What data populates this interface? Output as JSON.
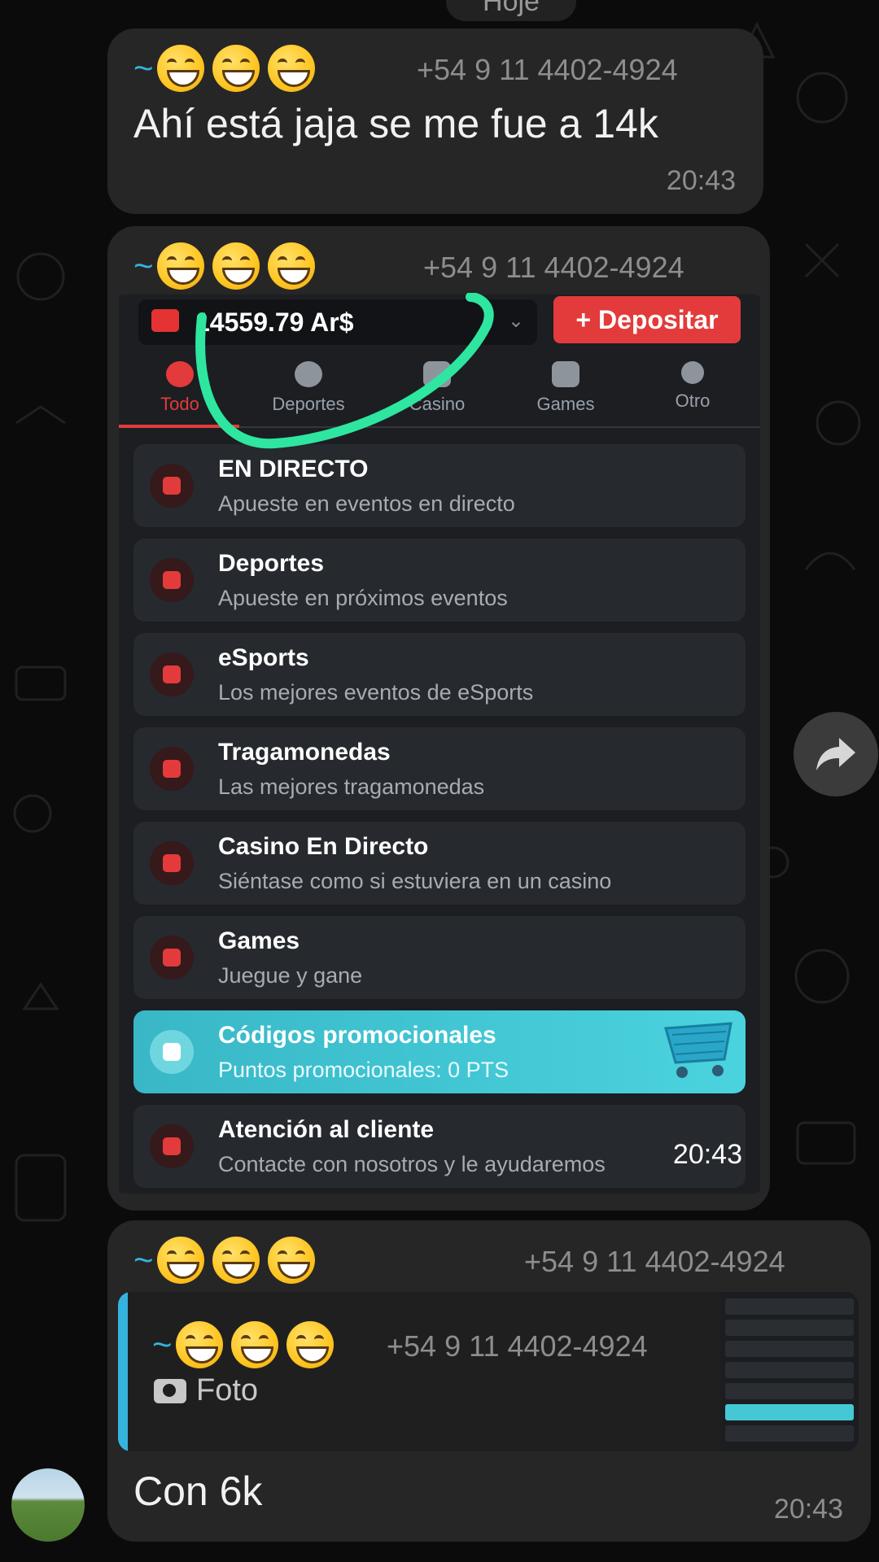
{
  "date_chip": "Hoje",
  "messages": [
    {
      "sender_prefix": "~",
      "phone": "+54 9 11 4402-4924",
      "text": "Ahí está jaja se me fue a 14k",
      "time": "20:43"
    },
    {
      "sender_prefix": "~",
      "phone": "+54 9 11 4402-4924",
      "time": "20:43",
      "screenshot": {
        "balance": "14559.79 Ar$",
        "deposit_label": "+ Depositar",
        "tabs": [
          "Todo",
          "Deportes",
          "Casino",
          "Games",
          "Otro"
        ],
        "menu": [
          {
            "title": "EN DIRECTO",
            "subtitle": "Apueste en eventos en directo"
          },
          {
            "title": "Deportes",
            "subtitle": "Apueste en próximos eventos"
          },
          {
            "title": "eSports",
            "subtitle": "Los mejores eventos de eSports"
          },
          {
            "title": "Tragamonedas",
            "subtitle": "Las mejores tragamonedas"
          },
          {
            "title": "Casino En Directo",
            "subtitle": "Siéntase como si estuviera en un casino"
          },
          {
            "title": "Games",
            "subtitle": "Juegue y gane"
          },
          {
            "title": "Códigos promocionales",
            "subtitle": "Puntos promocionales: 0 PTS"
          },
          {
            "title": "Atención al cliente",
            "subtitle": "Contacte con nosotros y le ayudaremos"
          }
        ],
        "time": "20:43"
      }
    },
    {
      "sender_prefix": "~",
      "phone": "+54 9 11 4402-4924",
      "quote": {
        "sender_prefix": "~",
        "phone": "+54 9 11 4402-4924",
        "label": "Foto"
      },
      "text": "Con 6k",
      "time": "20:43"
    }
  ],
  "colors": {
    "bubble": "#262626",
    "accent_blue": "#35b3de",
    "brand_red": "#e33b3b",
    "promo_teal": "#45c8d4",
    "highlight_green": "#2ee6a0"
  },
  "icons": [
    "grinning-face-emoji",
    "forward-icon",
    "camera-icon",
    "wallet-icon"
  ]
}
